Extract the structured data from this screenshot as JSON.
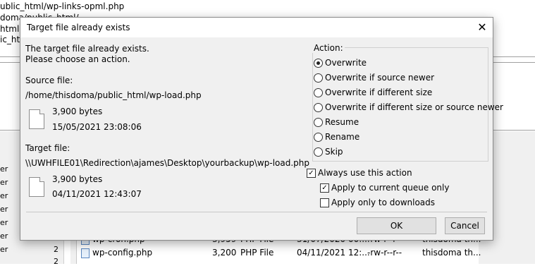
{
  "background": {
    "path_lines": [
      "ublic_html/wp-links-opml.php",
      "doma/public_html/",
      "html",
      "ic_htr"
    ],
    "left_items": [
      "er",
      "er",
      "er",
      "er",
      "er",
      "er",
      "er"
    ],
    "left_counts": [
      "2",
      "2"
    ],
    "files": [
      {
        "name": "wp-cron.php",
        "size": "3,959",
        "type": "PHP File",
        "modified": "31/07/2020 00:...",
        "perms": "-rw-r--r--",
        "owner": "thisdoma th..."
      },
      {
        "name": "wp-config.php",
        "size": "3,200",
        "type": "PHP File",
        "modified": "04/11/2021 12:...",
        "perms": "-rw-r--r--",
        "owner": "thisdoma th..."
      }
    ]
  },
  "dialog": {
    "title": "Target file already exists",
    "close_glyph": "✕",
    "message_line1": "The target file already exists.",
    "message_line2": "Please choose an action.",
    "source": {
      "label": "Source file:",
      "path": "/home/thisdoma/public_html/wp-load.php",
      "size": "3,900 bytes",
      "date": "15/05/2021 23:08:06"
    },
    "target": {
      "label": "Target file:",
      "path": "\\\\UWHFILE01\\Redirection\\ajames\\Desktop\\yourbackup\\wp-load.php",
      "size": "3,900 bytes",
      "date": "04/11/2021 12:43:07"
    },
    "action_label": "Action:",
    "actions": [
      "Overwrite",
      "Overwrite if source newer",
      "Overwrite if different size",
      "Overwrite if different size or source newer",
      "Resume",
      "Rename",
      "Skip"
    ],
    "selected_action": "Overwrite",
    "always_use": {
      "label": "Always use this action",
      "checked": true
    },
    "apply_queue": {
      "label": "Apply to current queue only",
      "checked": true
    },
    "apply_downloads": {
      "label": "Apply only to downloads",
      "checked": false
    },
    "ok_label": "OK",
    "cancel_label": "Cancel",
    "check_glyph": "✓"
  }
}
